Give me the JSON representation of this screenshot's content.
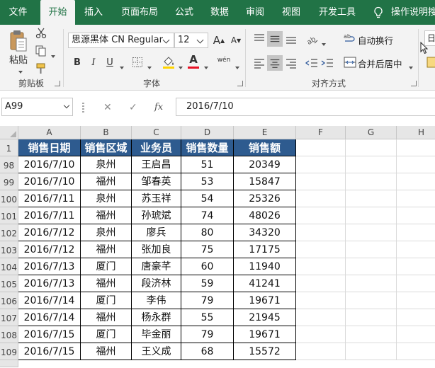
{
  "menu": {
    "tabs": [
      {
        "label": "文件"
      },
      {
        "label": "开始"
      },
      {
        "label": "插入"
      },
      {
        "label": "页面布局"
      },
      {
        "label": "公式"
      },
      {
        "label": "数据"
      },
      {
        "label": "审阅"
      },
      {
        "label": "视图"
      },
      {
        "label": "开发工具"
      }
    ],
    "active_tab": "开始",
    "tell_me": "操作说明搜"
  },
  "ribbon": {
    "clipboard": {
      "paste_label": "粘贴",
      "group_label": "剪贴板"
    },
    "font": {
      "font_name": "思源黑体 CN Regular",
      "font_size": "12",
      "group_label": "字体",
      "bold": "B",
      "italic": "I",
      "underline": "U",
      "font_color_glyph": "A",
      "phonetic_glyph": "wén"
    },
    "alignment": {
      "wrap_text": "自动换行",
      "merge_center": "合并后居中",
      "group_label": "对齐方式"
    },
    "overflow_label": "日"
  },
  "formula_bar": {
    "name_box": "A99",
    "fx": "fx",
    "formula": "2016/7/10"
  },
  "sheet": {
    "columns": [
      "A",
      "B",
      "C",
      "D",
      "E",
      "F",
      "G",
      "H"
    ],
    "header_row_number": "1",
    "headers": [
      "销售日期",
      "销售区域",
      "业务员",
      "销售数量",
      "销售额"
    ],
    "rows": [
      {
        "n": "98",
        "cells": [
          "2016/7/10",
          "泉州",
          "王启昌",
          "51",
          "20349"
        ]
      },
      {
        "n": "99",
        "cells": [
          "2016/7/10",
          "福州",
          "邹春英",
          "53",
          "15847"
        ]
      },
      {
        "n": "100",
        "cells": [
          "2016/7/11",
          "泉州",
          "苏玉祥",
          "54",
          "25326"
        ]
      },
      {
        "n": "101",
        "cells": [
          "2016/7/11",
          "福州",
          "孙琥斌",
          "74",
          "48026"
        ]
      },
      {
        "n": "102",
        "cells": [
          "2016/7/12",
          "泉州",
          "廖兵",
          "80",
          "34320"
        ]
      },
      {
        "n": "103",
        "cells": [
          "2016/7/12",
          "福州",
          "张加良",
          "75",
          "17175"
        ]
      },
      {
        "n": "104",
        "cells": [
          "2016/7/13",
          "厦门",
          "唐豪芊",
          "60",
          "11940"
        ]
      },
      {
        "n": "105",
        "cells": [
          "2016/7/13",
          "福州",
          "段济林",
          "59",
          "41241"
        ]
      },
      {
        "n": "106",
        "cells": [
          "2016/7/14",
          "厦门",
          "李伟",
          "79",
          "19671"
        ]
      },
      {
        "n": "107",
        "cells": [
          "2016/7/14",
          "福州",
          "杨永群",
          "55",
          "21945"
        ]
      },
      {
        "n": "108",
        "cells": [
          "2016/7/15",
          "厦门",
          "毕金丽",
          "79",
          "19671"
        ]
      },
      {
        "n": "109",
        "cells": [
          "2016/7/15",
          "福州",
          "王义成",
          "68",
          "15572"
        ]
      }
    ]
  },
  "colors": {
    "accent": "#217346",
    "table_header": "#2e5b8f",
    "font_color": "#e81123",
    "fill_color": "#ffd400"
  }
}
